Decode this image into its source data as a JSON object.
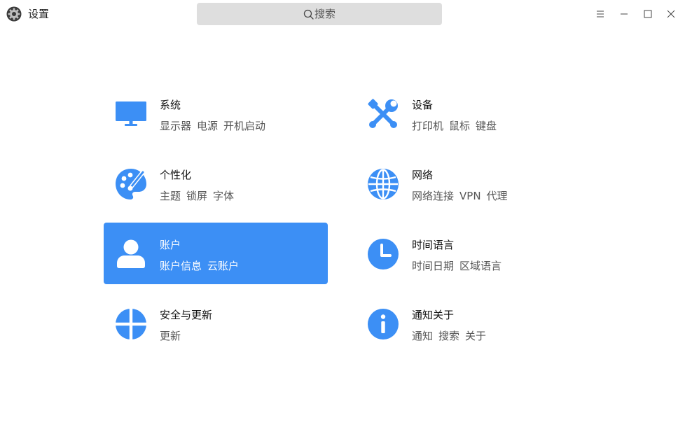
{
  "window": {
    "title": "设置",
    "accent": "#3c8ff5"
  },
  "search": {
    "placeholder": "搜索"
  },
  "categories": [
    {
      "title": "系统",
      "icon": "monitor-icon",
      "items": [
        "显示器",
        "电源",
        "开机启动"
      ],
      "active": false
    },
    {
      "title": "设备",
      "icon": "tools-icon",
      "items": [
        "打印机",
        "鼠标",
        "键盘"
      ],
      "active": false
    },
    {
      "title": "个性化",
      "icon": "palette-icon",
      "items": [
        "主题",
        "锁屏",
        "字体"
      ],
      "active": false
    },
    {
      "title": "网络",
      "icon": "globe-icon",
      "items": [
        "网络连接",
        "VPN",
        "代理"
      ],
      "active": false
    },
    {
      "title": "账户",
      "icon": "user-icon",
      "items": [
        "账户信息",
        "云账户"
      ],
      "active": true
    },
    {
      "title": "时间语言",
      "icon": "clock-icon",
      "items": [
        "时间日期",
        "区域语言"
      ],
      "active": false
    },
    {
      "title": "安全与更新",
      "icon": "shield-icon",
      "items": [
        "更新"
      ],
      "active": false
    },
    {
      "title": "通知关于",
      "icon": "info-icon",
      "items": [
        "通知",
        "搜索",
        "关于"
      ],
      "active": false
    }
  ]
}
